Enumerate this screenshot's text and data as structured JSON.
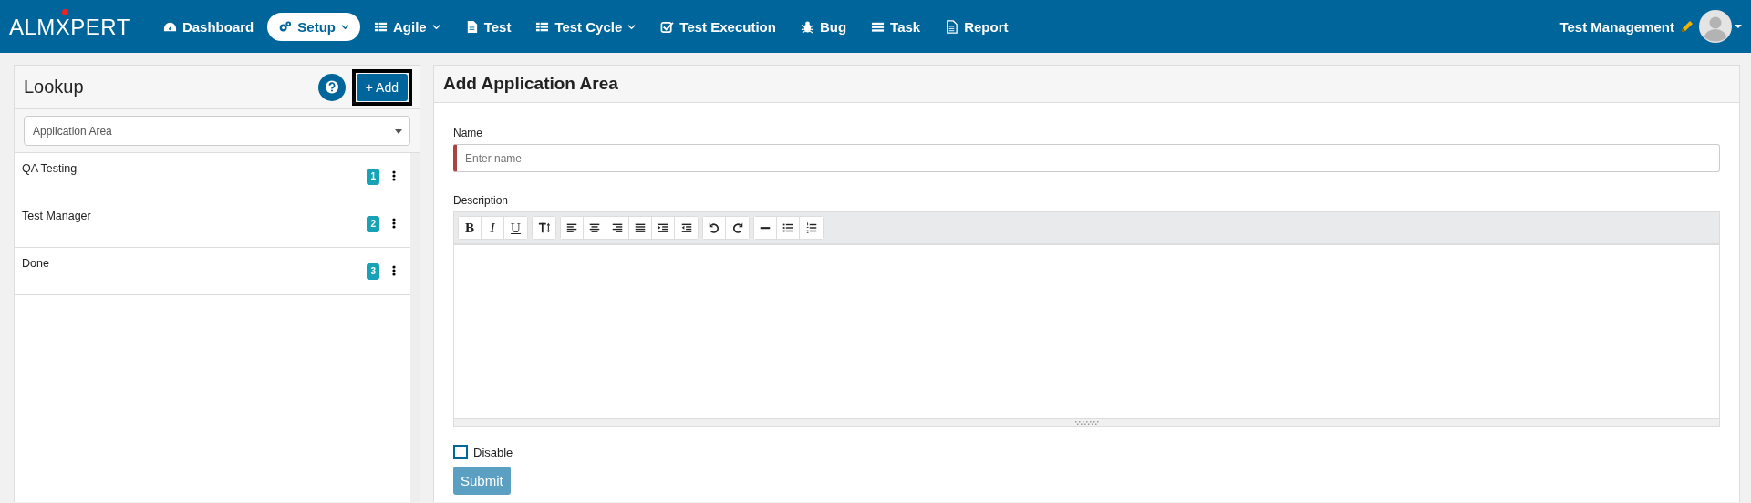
{
  "brand": {
    "logo": "ALMXPERT"
  },
  "nav": [
    {
      "kind": "gauge",
      "label": "Dashboard",
      "selected": false,
      "dropdown": false
    },
    {
      "kind": "gears",
      "label": "Setup",
      "selected": true,
      "dropdown": true
    },
    {
      "kind": "table",
      "label": "Agile",
      "selected": false,
      "dropdown": true
    },
    {
      "kind": "doc",
      "label": "Test",
      "selected": false,
      "dropdown": false
    },
    {
      "kind": "table",
      "label": "Test Cycle",
      "selected": false,
      "dropdown": true
    },
    {
      "kind": "check",
      "label": "Test Execution",
      "selected": false,
      "dropdown": false
    },
    {
      "kind": "bug",
      "label": "Bug",
      "selected": false,
      "dropdown": false
    },
    {
      "kind": "list",
      "label": "Task",
      "selected": false,
      "dropdown": false
    },
    {
      "kind": "report",
      "label": "Report",
      "selected": false,
      "dropdown": false
    }
  ],
  "user": {
    "project": "Test Management"
  },
  "lookup": {
    "title": "Lookup",
    "add_button": "+ Add",
    "select": "Application Area",
    "items": [
      {
        "name": "QA Testing",
        "count": "1"
      },
      {
        "name": "Test Manager",
        "count": "2"
      },
      {
        "name": "Done",
        "count": "3"
      }
    ]
  },
  "form": {
    "title": "Add Application Area",
    "name_label": "Name",
    "name_placeholder": "Enter name",
    "name_required": true,
    "description_label": "Description",
    "toolbar": [
      [
        {
          "kind": "bold",
          "label": "B"
        },
        {
          "kind": "italic",
          "label": "I"
        },
        {
          "kind": "underline",
          "label": "U"
        }
      ],
      [
        {
          "kind": "fontsize"
        }
      ],
      [
        {
          "kind": "align-left"
        },
        {
          "kind": "align-center"
        },
        {
          "kind": "align-right"
        },
        {
          "kind": "justify"
        },
        {
          "kind": "indent"
        },
        {
          "kind": "outdent"
        }
      ],
      [
        {
          "kind": "undo"
        },
        {
          "kind": "redo"
        }
      ],
      [
        {
          "kind": "hr"
        },
        {
          "kind": "ul"
        },
        {
          "kind": "ol"
        }
      ]
    ],
    "disable": {
      "label": "Disable",
      "checked": false
    },
    "submit": {
      "label": "Submit",
      "disabled": true
    }
  }
}
